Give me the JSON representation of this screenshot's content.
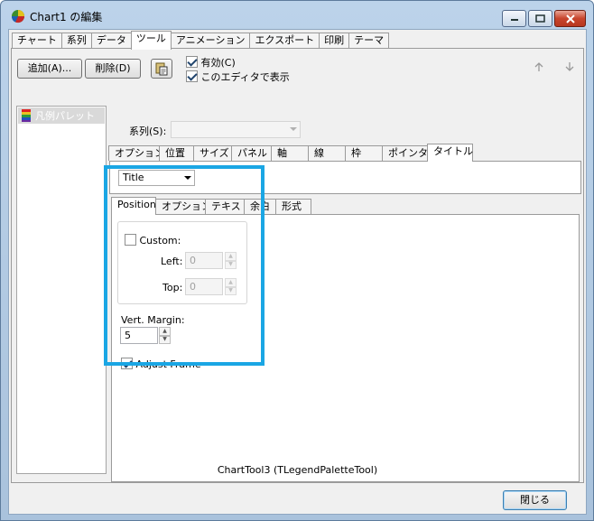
{
  "window": {
    "title": "Chart1 の編集"
  },
  "main_tabs": [
    {
      "label": "チャート"
    },
    {
      "label": "系列"
    },
    {
      "label": "データ"
    },
    {
      "label": "ツール"
    },
    {
      "label": "アニメーション"
    },
    {
      "label": "エクスポート"
    },
    {
      "label": "印刷"
    },
    {
      "label": "テーマ"
    }
  ],
  "toolbar": {
    "add_label": "追加(A)...",
    "delete_label": "削除(D)",
    "enabled_label": "有効(C)",
    "show_in_editor_label": "このエディタで表示",
    "enabled_checked": true,
    "show_in_editor_checked": true
  },
  "tools_list": [
    {
      "label": "凡例パレット",
      "icon": "legend-palette-icon"
    }
  ],
  "series_label": "系列(S):",
  "series_value": "",
  "sub_tabs": [
    {
      "label": "オプション"
    },
    {
      "label": "位置"
    },
    {
      "label": "サイズ"
    },
    {
      "label": "パネル"
    },
    {
      "label": "軸"
    },
    {
      "label": "線"
    },
    {
      "label": "枠"
    },
    {
      "label": "ポインタ"
    },
    {
      "label": "タイトル"
    }
  ],
  "title_combo_value": "Title",
  "inner_tabs": [
    {
      "label": "Position"
    },
    {
      "label": "オプション"
    },
    {
      "label": "テキスト"
    },
    {
      "label": "余白"
    },
    {
      "label": "形式"
    }
  ],
  "position": {
    "custom_label": "Custom:",
    "custom_checked": false,
    "left_label": "Left:",
    "left_value": "0",
    "top_label": "Top:",
    "top_value": "0",
    "vert_margin_label": "Vert. Margin:",
    "vert_margin_value": "5",
    "adjust_frame_label": "Adjust Frame",
    "adjust_frame_checked": true
  },
  "status_text": "ChartTool3 (TLegendPaletteTool)",
  "close_button_label": "閉じる",
  "colors": {
    "highlight": "#1aa6e4"
  }
}
